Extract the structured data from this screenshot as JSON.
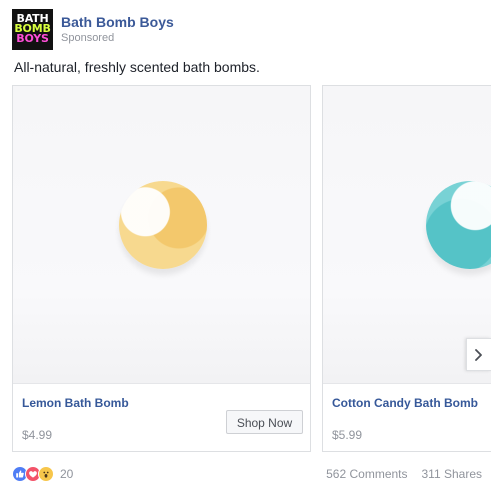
{
  "post": {
    "page_name": "Bath Bomb Boys",
    "sponsored_label": "Sponsored",
    "caption": "All-natural, freshly scented bath bombs.",
    "logo_lines": [
      "Bath",
      "Bomb",
      "Boys"
    ]
  },
  "carousel": {
    "cards": [
      {
        "title": "Lemon Bath Bomb",
        "price": "$4.99",
        "button_label": "Shop Now",
        "image": "lemon-bath-bomb"
      },
      {
        "title": "Cotton Candy Bath Bomb",
        "price": "$5.99",
        "image": "cotton-candy-bath-bomb"
      }
    ],
    "next_icon": "chevron-right-icon"
  },
  "footer": {
    "reaction_icons": [
      "like-icon",
      "love-icon",
      "wow-icon"
    ],
    "reaction_count": "20",
    "comments": "562 Comments",
    "shares": "311 Shares"
  },
  "colors": {
    "link_blue": "#3b5998",
    "muted_gray": "#90949c",
    "button_bg": "#f6f7f9",
    "lemon_yellow": "#f3c86c",
    "cotton_teal": "#55c3c7"
  }
}
